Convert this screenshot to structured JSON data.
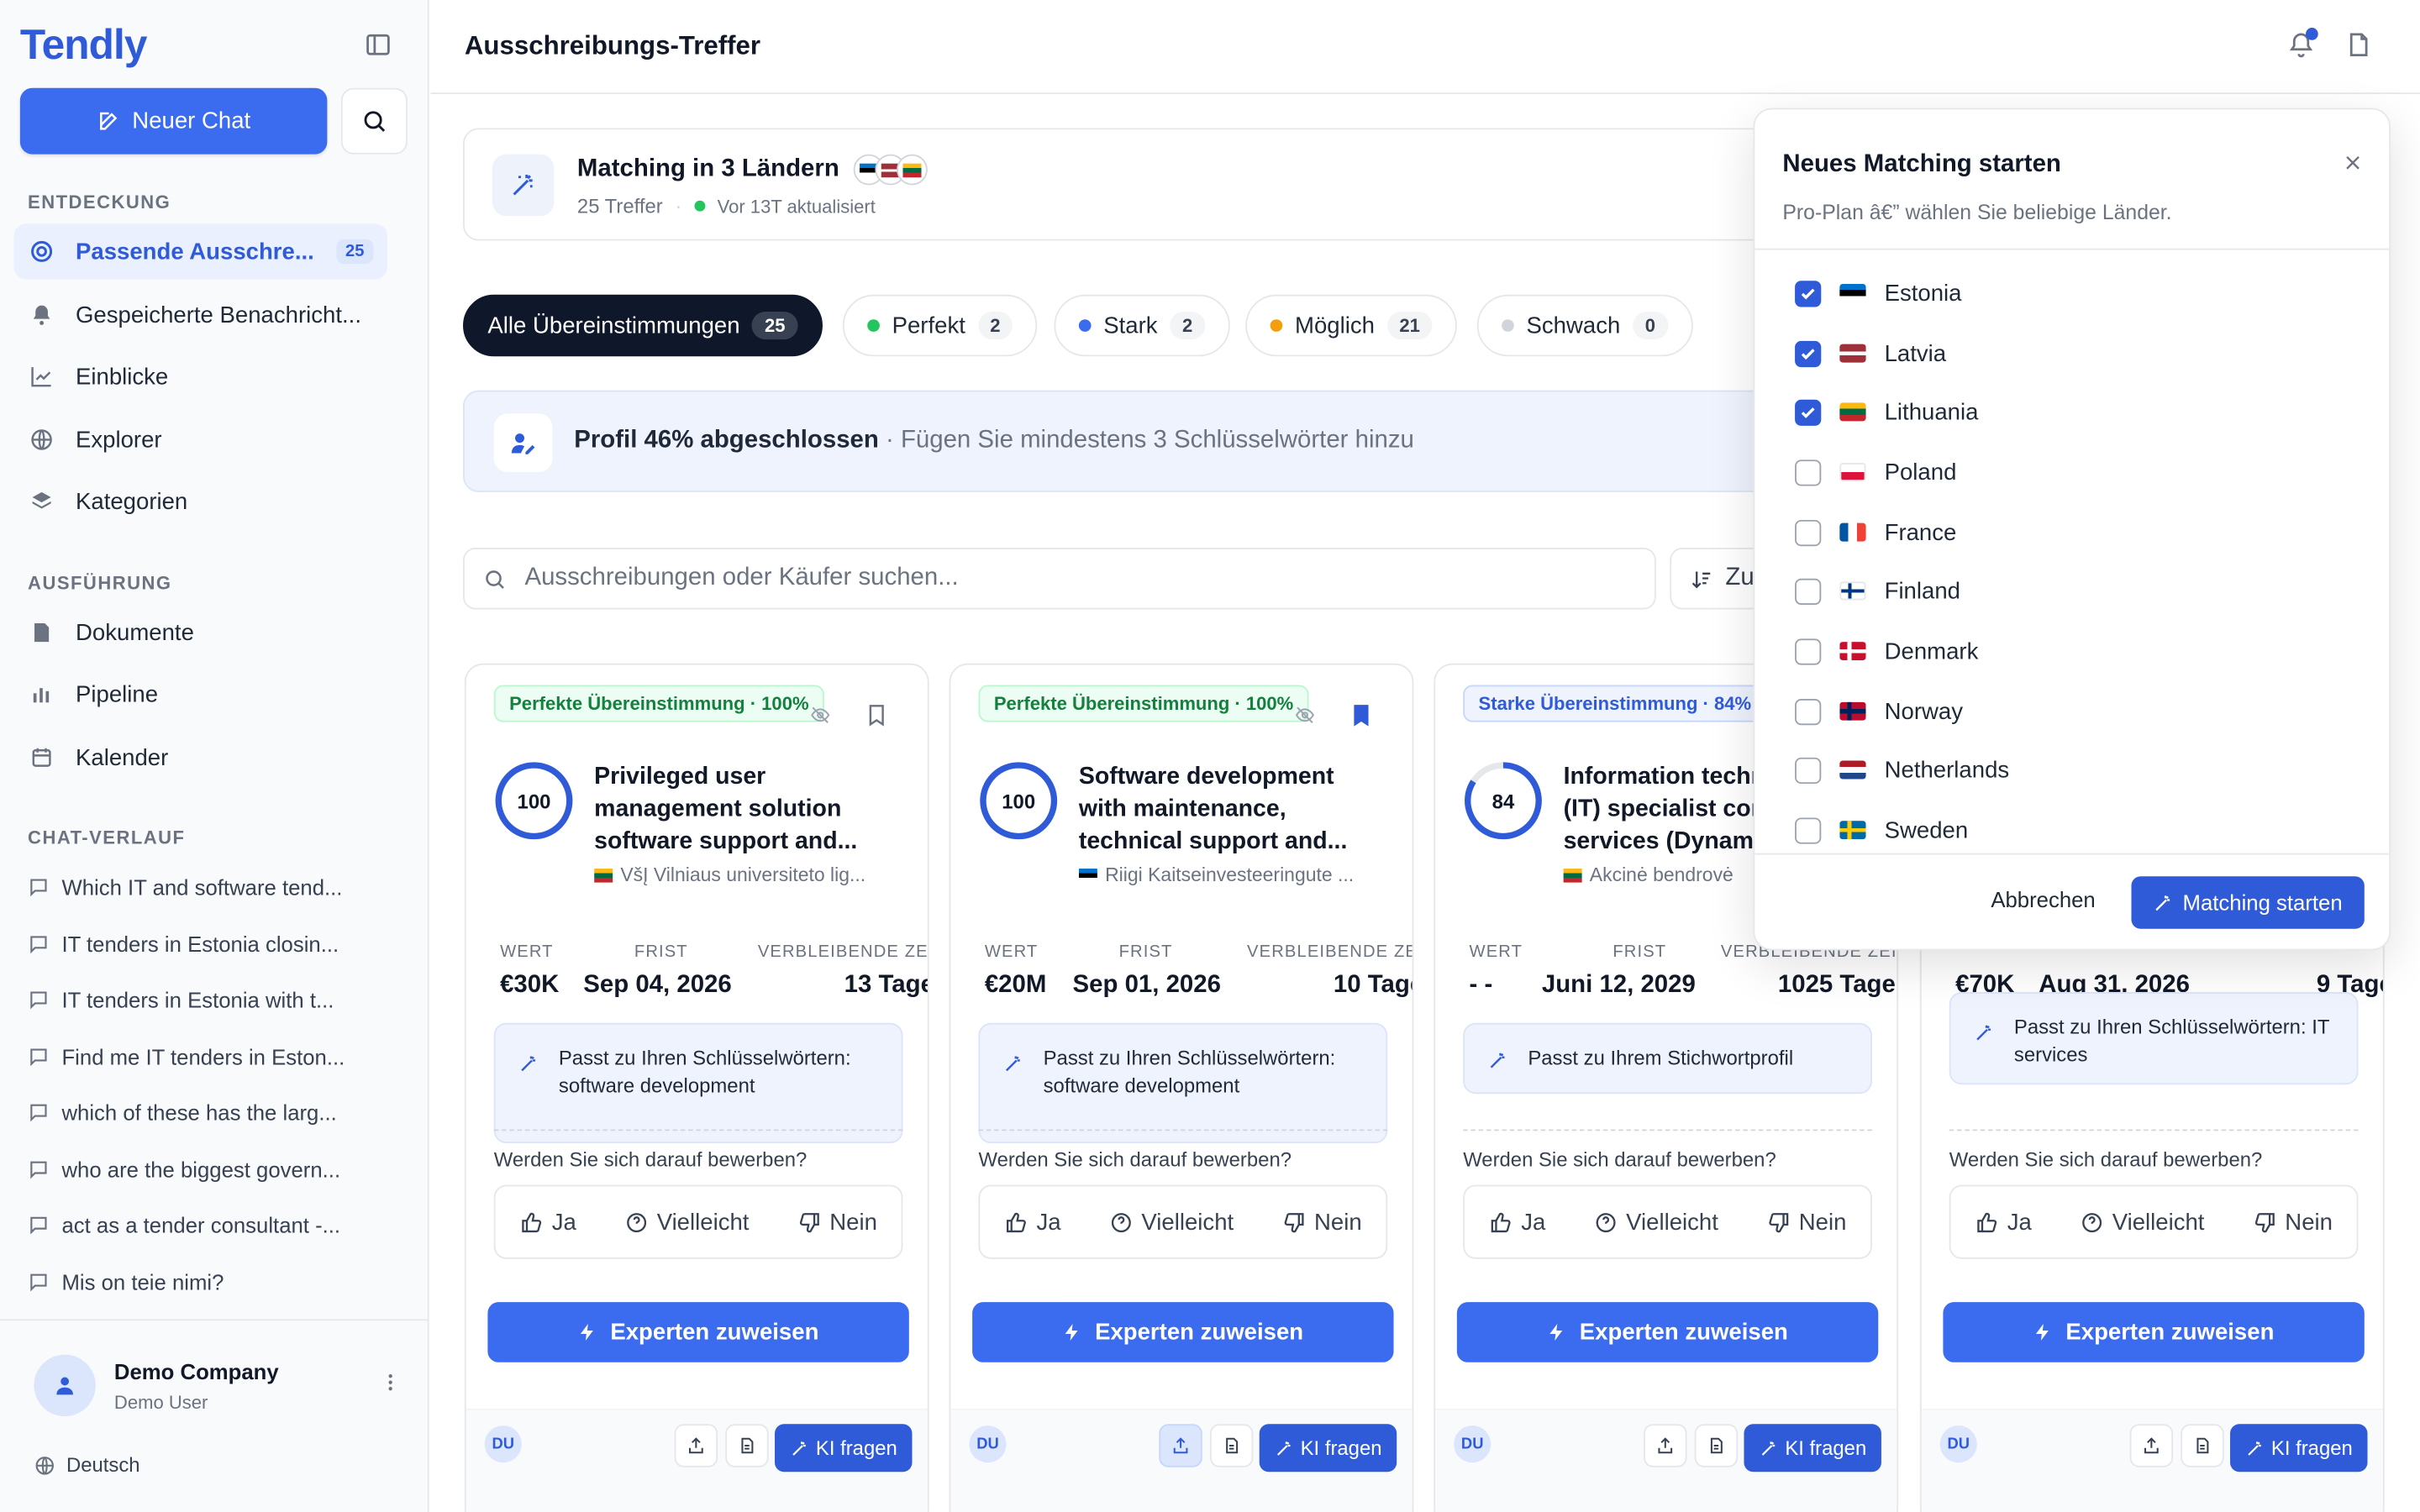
{
  "sidebar": {
    "logo": "Tendly",
    "new_chat": "Neuer Chat",
    "sections": {
      "discovery": "ENTDECKUNG",
      "execution": "AUSFÜHRUNG",
      "history": "CHAT-VERLAUF"
    },
    "discovery_items": [
      {
        "label": "Passende Ausschre...",
        "badge": "25",
        "icon": "target-icon"
      },
      {
        "label": "Gespeicherte Benachricht...",
        "icon": "bell-icon"
      },
      {
        "label": "Einblicke",
        "icon": "chart-line-icon"
      },
      {
        "label": "Explorer",
        "icon": "globe-icon"
      },
      {
        "label": "Kategorien",
        "icon": "layers-icon"
      }
    ],
    "execution_items": [
      {
        "label": "Dokumente",
        "icon": "document-icon"
      },
      {
        "label": "Pipeline",
        "icon": "bar-chart-icon"
      },
      {
        "label": "Kalender",
        "icon": "calendar-icon"
      }
    ],
    "chats": [
      "Which IT and software tend...",
      "IT tenders in Estonia closin...",
      "IT tenders in Estonia with t...",
      "Find me IT tenders in Eston...",
      "which of these has the larg...",
      "who are the biggest govern...",
      "act as a tender consultant -...",
      "Mis on teie nimi?"
    ],
    "user": {
      "company": "Demo Company",
      "role": "Demo User"
    },
    "language": "Deutsch"
  },
  "header": {
    "title": "Ausschreibungs-Treffer"
  },
  "matching": {
    "title": "Matching in 3 Ländern",
    "count": "25 Treffer",
    "updated": "Vor 13T aktualisiert"
  },
  "filters": [
    {
      "label": "Alle Übereinstimmungen",
      "count": "25"
    },
    {
      "label": "Perfekt",
      "count": "2",
      "color": "#22c55e"
    },
    {
      "label": "Stark",
      "count": "2",
      "color": "#3b6cf0"
    },
    {
      "label": "Möglich",
      "count": "21",
      "color": "#f59e0b"
    },
    {
      "label": "Schwach",
      "count": "0",
      "color": "#d1d5db"
    }
  ],
  "profile": {
    "strong": "Profil 46% abgeschlossen",
    "rest": " · Fügen Sie mindestens 3 Schlüsselwörter hinzu"
  },
  "search": {
    "placeholder": "Ausschreibungen oder Käufer suchen...",
    "sort": "Zu"
  },
  "labels": {
    "value": "WERT",
    "deadline": "FRIST",
    "remaining": "VERBLEIBENDE ZEIT",
    "question": "Werden Sie sich darauf bewerben?",
    "yes": "Ja",
    "maybe": "Vielleicht",
    "no": "Nein",
    "expert": "Experten zuweisen",
    "ask_ai": "KI fragen",
    "initials": "DU"
  },
  "cards": [
    {
      "badge": "Perfekte Übereinstimmung · 100%",
      "score": "100",
      "score_fraction": 1.0,
      "title": "Privileged user management solution software support and...",
      "buyer": "VšĮ Vilniaus universiteto lig...",
      "value": "€30K",
      "deadline": "Sep 04, 2026",
      "remaining": "13 Tage",
      "keyword": "Passt zu Ihren Schlüsselwörtern: software development"
    },
    {
      "badge": "Perfekte Übereinstimmung · 100%",
      "score": "100",
      "score_fraction": 1.0,
      "title": "Software development with maintenance, technical support and...",
      "buyer": "Riigi Kaitseinvesteeringute ...",
      "value": "€20M",
      "deadline": "Sep 01, 2026",
      "remaining": "10 Tage",
      "keyword": "Passt zu Ihren Schlüsselwörtern: software development"
    },
    {
      "badge": "Starke Übereinstimmung · 84%",
      "score": "84",
      "score_fraction": 0.84,
      "title": "Information technology (IT) specialist consulting services (Dynamics...",
      "buyer": "Akcinė bendrovė",
      "value": "- -",
      "deadline": "Juni 12, 2029",
      "remaining": "1025 Tage",
      "keyword": "Passt zu Ihrem Stichwortprofil"
    },
    {
      "value": "€70K",
      "deadline": "Aug 31, 2026",
      "remaining": "9 Tage",
      "keyword": "Passt zu Ihren Schlüsselwörtern: IT services"
    }
  ],
  "popup": {
    "title": "Neues Matching starten",
    "subtitle": "Pro-Plan â€” wählen Sie beliebige Länder.",
    "countries": [
      {
        "name": "Estonia",
        "checked": true
      },
      {
        "name": "Latvia",
        "checked": true
      },
      {
        "name": "Lithuania",
        "checked": true
      },
      {
        "name": "Poland",
        "checked": false
      },
      {
        "name": "France",
        "checked": false
      },
      {
        "name": "Finland",
        "checked": false
      },
      {
        "name": "Denmark",
        "checked": false
      },
      {
        "name": "Norway",
        "checked": false
      },
      {
        "name": "Netherlands",
        "checked": false
      },
      {
        "name": "Sweden",
        "checked": false
      }
    ],
    "cancel": "Abbrechen",
    "start": "Matching starten"
  }
}
